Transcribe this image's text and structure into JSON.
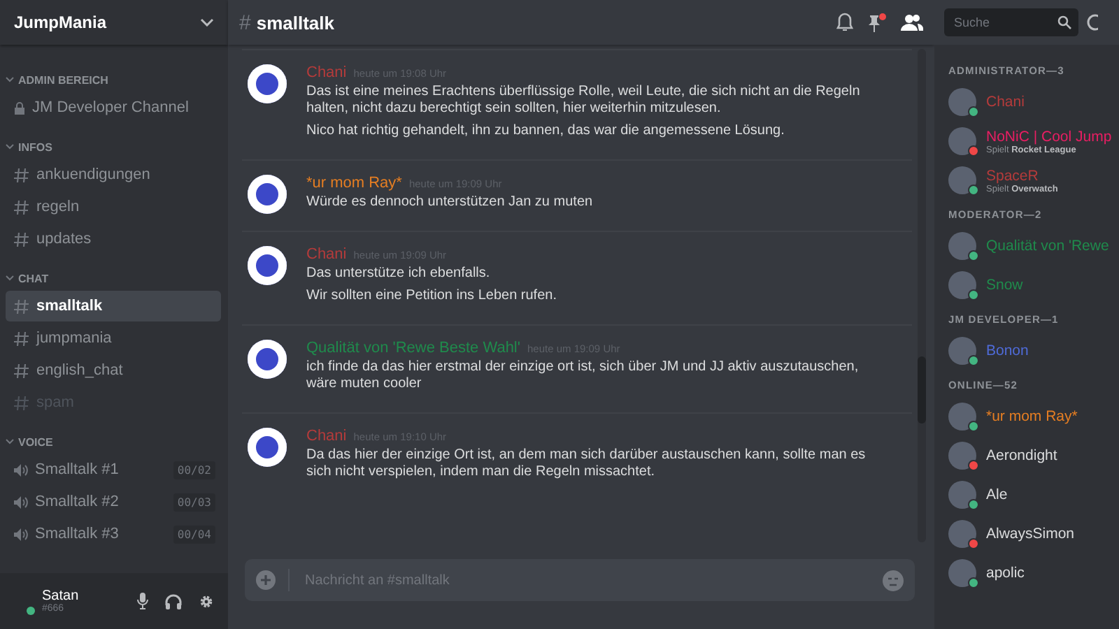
{
  "server": {
    "name": "JumpMania"
  },
  "categories": [
    {
      "name": "ADMIN BEREICH",
      "channels": [
        {
          "name": "JM Developer Channel",
          "kind": "locked",
          "selected": false,
          "muted": false
        }
      ]
    },
    {
      "name": "INFOS",
      "channels": [
        {
          "name": "ankuendigungen",
          "kind": "text",
          "selected": false,
          "muted": false
        },
        {
          "name": "regeln",
          "kind": "text",
          "selected": false,
          "muted": false
        },
        {
          "name": "updates",
          "kind": "text",
          "selected": false,
          "muted": false
        }
      ]
    },
    {
      "name": "CHAT",
      "channels": [
        {
          "name": "smalltalk",
          "kind": "text",
          "selected": true,
          "muted": false
        },
        {
          "name": "jumpmania",
          "kind": "text",
          "selected": false,
          "muted": false
        },
        {
          "name": "english_chat",
          "kind": "text",
          "selected": false,
          "muted": false
        },
        {
          "name": "spam",
          "kind": "text",
          "selected": false,
          "muted": true
        }
      ]
    },
    {
      "name": "VOICE",
      "channels": [
        {
          "name": "Smalltalk #1",
          "kind": "voice",
          "selected": false,
          "muted": false,
          "count": "00/02"
        },
        {
          "name": "Smalltalk #2",
          "kind": "voice",
          "selected": false,
          "muted": false,
          "count": "00/03"
        },
        {
          "name": "Smalltalk #3",
          "kind": "voice",
          "selected": false,
          "muted": false,
          "count": "00/04"
        }
      ]
    }
  ],
  "user": {
    "name": "Satan",
    "tag": "#666",
    "busy": false
  },
  "channel_header": {
    "hash": "#",
    "name": "smalltalk"
  },
  "search": {
    "placeholder": "Suche"
  },
  "messages": [
    {
      "author": "Chani",
      "color": "#b53b3b",
      "time": "heute um 19:08 Uhr",
      "lines": [
        "Das ist eine meines Erachtens überflüssige Rolle, weil Leute, die sich nicht an die Regeln halten, nicht dazu berechtigt sein sollten, hier weiterhin mitzulesen.",
        "Nico hat richtig gehandelt, ihn zu bannen, das war die angemessene Lösung."
      ]
    },
    {
      "author": "*ur mom Ray*",
      "color": "#e67e22",
      "time": "heute um 19:09 Uhr",
      "lines": [
        "Würde es dennoch unterstützen Jan zu muten"
      ]
    },
    {
      "author": "Chani",
      "color": "#b53b3b",
      "time": "heute um 19:09 Uhr",
      "lines": [
        "Das unterstütze ich ebenfalls.",
        "Wir sollten eine Petition ins Leben rufen."
      ]
    },
    {
      "author": "Qualität von 'Rewe Beste Wahl'",
      "color": "#1f8b4c",
      "time": "heute um 19:09 Uhr",
      "lines": [
        "ich finde da das hier erstmal der einzige ort ist, sich über JM und JJ aktiv auszutauschen, wäre muten cooler"
      ]
    },
    {
      "author": "Chani",
      "color": "#b53b3b",
      "time": "heute um 19:10 Uhr",
      "lines": [
        "Da das hier der einzige Ort ist, an dem man sich darüber austauschen kann, sollte man es sich nicht verspielen, indem man die Regeln missachtet."
      ]
    }
  ],
  "composer": {
    "placeholder": "Nachricht an #smalltalk"
  },
  "member_groups": [
    {
      "title": "ADMINISTRATOR—3",
      "members": [
        {
          "name": "Chani",
          "color": "#b53b3b",
          "busy": false
        },
        {
          "name": "NoNiC | Cool Jump",
          "color": "#e91e63",
          "busy": true,
          "activity": "Spielt",
          "game": "Rocket League"
        },
        {
          "name": "SpaceR",
          "color": "#b53b3b",
          "busy": false,
          "activity": "Spielt",
          "game": "Overwatch"
        }
      ]
    },
    {
      "title": "MODERATOR—2",
      "members": [
        {
          "name": "Qualität von 'Rewe",
          "color": "#1f8b4c",
          "busy": false
        },
        {
          "name": "Snow",
          "color": "#1f8b4c",
          "busy": false
        }
      ]
    },
    {
      "title": "JM DEVELOPER—1",
      "members": [
        {
          "name": "Bonon",
          "color": "#4f6bd8",
          "busy": false
        }
      ]
    },
    {
      "title": "ONLINE—52",
      "members": [
        {
          "name": "*ur mom Ray*",
          "color": "#e67e22",
          "busy": false
        },
        {
          "name": "Aerondight",
          "color": "#dcddde",
          "busy": true
        },
        {
          "name": "Ale",
          "color": "#dcddde",
          "busy": false
        },
        {
          "name": "AlwaysSimon",
          "color": "#dcddde",
          "busy": true
        },
        {
          "name": "apolic",
          "color": "#dcddde",
          "busy": false
        }
      ]
    }
  ]
}
